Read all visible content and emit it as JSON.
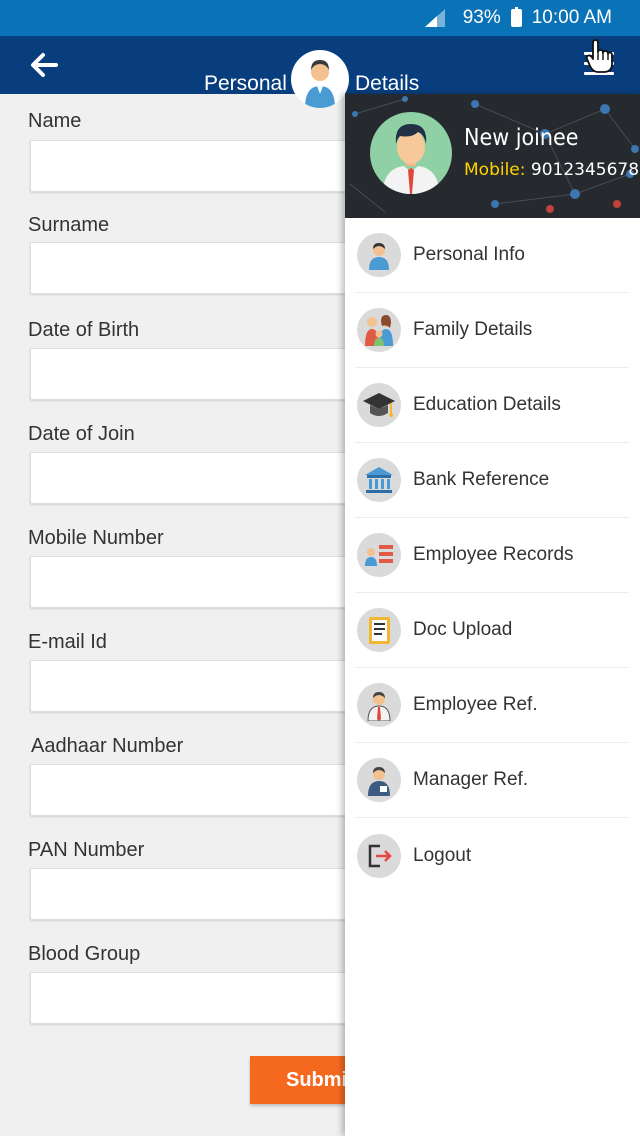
{
  "status_bar": {
    "battery": "93%",
    "time": "10:00 AM"
  },
  "app_bar": {
    "title_left": "Personal",
    "title_right": "Details"
  },
  "form": {
    "fields": [
      {
        "label": "Name",
        "value": ""
      },
      {
        "label": "Surname",
        "value": ""
      },
      {
        "label": "Date of Birth",
        "value": ""
      },
      {
        "label": "Date of Join",
        "value": ""
      },
      {
        "label": "Mobile Number",
        "value": ""
      },
      {
        "label": "E-mail Id",
        "value": ""
      },
      {
        "label": "Aadhaar Number",
        "value": ""
      },
      {
        "label": "PAN Number",
        "value": ""
      },
      {
        "label": "Blood Group",
        "value": ""
      }
    ],
    "submit_label": "Submi"
  },
  "drawer": {
    "user_name": "New  joinee",
    "mobile_label": "Mobile:",
    "mobile_value": "9012345678",
    "items": [
      {
        "label": "Personal Info",
        "icon": "person-icon"
      },
      {
        "label": "Family Details",
        "icon": "family-icon"
      },
      {
        "label": "Education Details",
        "icon": "graduation-cap-icon"
      },
      {
        "label": "Bank Reference",
        "icon": "bank-icon"
      },
      {
        "label": "Employee Records",
        "icon": "records-icon"
      },
      {
        "label": "Doc Upload",
        "icon": "document-icon"
      },
      {
        "label": "Employee Ref.",
        "icon": "employee-icon"
      },
      {
        "label": "Manager Ref.",
        "icon": "manager-icon"
      },
      {
        "label": "Logout",
        "icon": "logout-icon"
      }
    ]
  },
  "colors": {
    "status_bar": "#0a73b8",
    "app_bar": "#083e7e",
    "submit": "#f5691f",
    "mobile_label": "#ffd200"
  }
}
